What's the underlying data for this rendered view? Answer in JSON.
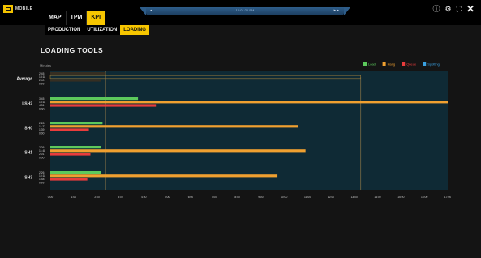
{
  "app": {
    "logo_text": "MOBILE",
    "nav_primary": [
      {
        "label": "MAP",
        "active": false
      },
      {
        "label": "TPM",
        "active": false
      },
      {
        "label": "KPI",
        "active": true
      }
    ],
    "nav_secondary": [
      {
        "label": "PRODUCTION",
        "active": false
      },
      {
        "label": "UTILIZATION",
        "active": false
      },
      {
        "label": "LOADING",
        "active": true
      }
    ],
    "handle_label": "10:01:21 PM",
    "window_controls": [
      "info-icon",
      "settings-icon",
      "fullscreen-icon",
      "close-icon"
    ]
  },
  "page": {
    "title": "LOADING TOOLS"
  },
  "chart_data": {
    "type": "bar",
    "orientation": "horizontal",
    "ylabel": "Minutes",
    "x_ticks": [
      "0:00",
      "1:00",
      "2:00",
      "3:00",
      "4:00",
      "5:00",
      "6:00",
      "7:00",
      "8:00",
      "9:00",
      "10:00",
      "11:00",
      "12:00",
      "13:00",
      "14:00",
      "15:00",
      "16:00",
      "17:00"
    ],
    "xlim": [
      0,
      1020
    ],
    "categories": [
      "Average",
      "LSH2",
      "SH0",
      "SH1",
      "SH3"
    ],
    "series": [
      {
        "name": "Load",
        "color": "#5cc95c"
      },
      {
        "name": "Hang",
        "color": "#f0a030"
      },
      {
        "name": "Queue",
        "color": "#e83c3c"
      },
      {
        "name": "Spotting",
        "color": "#3aa0e0"
      }
    ],
    "rows": [
      {
        "category": "Average",
        "values": [
          142,
          1122,
          130,
          0
        ],
        "labels": [
          "2:45",
          "13:18",
          "2:40",
          "0:00"
        ]
      },
      {
        "category": "LSH2",
        "values": [
          225,
          1020,
          271,
          0
        ],
        "labels": [
          "3:45",
          "15:18",
          "4:31",
          "0:00"
        ]
      },
      {
        "category": "SH0",
        "values": [
          134,
          637,
          99,
          0
        ],
        "labels": [
          "2:28",
          "11:22",
          "1:39",
          "0:00"
        ]
      },
      {
        "category": "SH1",
        "values": [
          130,
          655,
          103,
          0
        ],
        "labels": [
          "2:26",
          "11:48",
          "2:01",
          "0:00"
        ]
      },
      {
        "category": "SH3",
        "values": [
          130,
          583,
          95,
          0
        ],
        "labels": [
          "2:26",
          "10:18",
          "1:48",
          "0:00"
        ]
      }
    ],
    "legend_position": "top-right",
    "background": "#0f2a35"
  }
}
